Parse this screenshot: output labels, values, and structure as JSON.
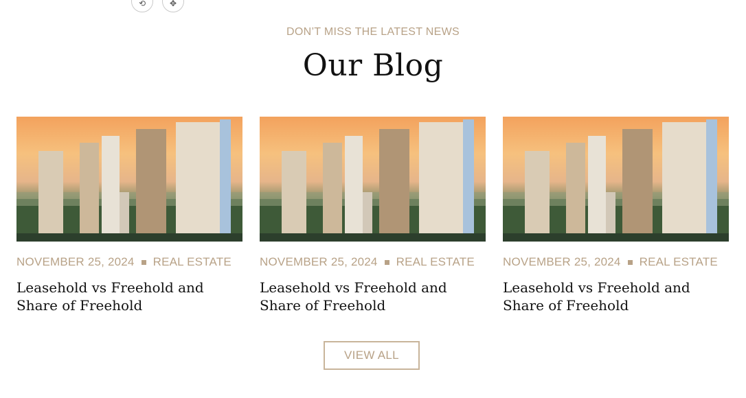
{
  "toolbar": {
    "rotate_icon": "rotate-icon",
    "move_icon": "move-icon",
    "rotate_glyph": "⟲",
    "move_glyph": "✥"
  },
  "section": {
    "eyebrow": "DON’T MISS THE LATEST NEWS",
    "title": "Our Blog"
  },
  "posts": [
    {
      "date": "NOVEMBER 25, 2024",
      "category": "REAL ESTATE",
      "title": "Leasehold vs Freehold and Share of Freehold",
      "image": "city-towers-sunset-image"
    },
    {
      "date": "NOVEMBER 25, 2024",
      "category": "REAL ESTATE",
      "title": "Leasehold vs Freehold and Share of Freehold",
      "image": "city-towers-sunset-image"
    },
    {
      "date": "NOVEMBER 25, 2024",
      "category": "REAL ESTATE",
      "title": "Leasehold vs Freehold and Share of Freehold",
      "image": "city-towers-sunset-image"
    }
  ],
  "view_all_label": "VIEW ALL",
  "colors": {
    "accent": "#b8a287",
    "border": "#c8b49a",
    "heading": "#111111"
  }
}
